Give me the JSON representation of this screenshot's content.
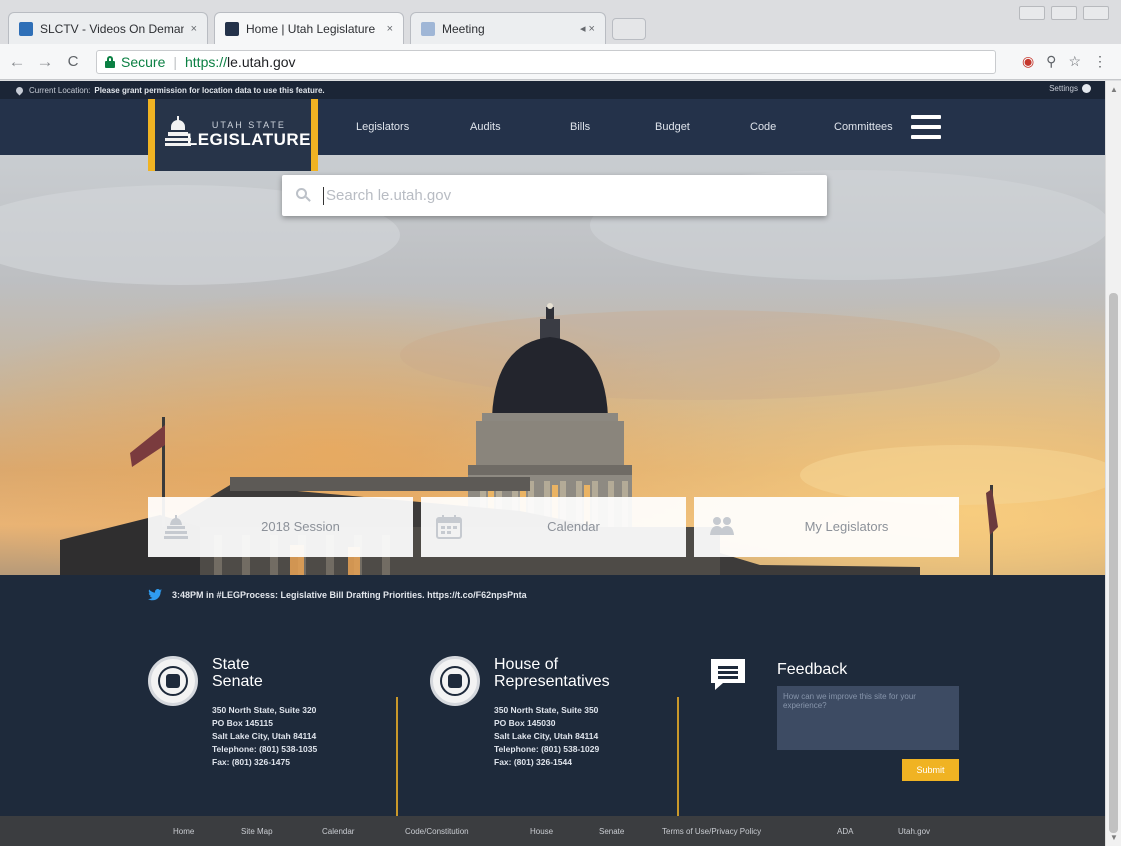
{
  "browser": {
    "tabs": [
      {
        "title": "SLCTV - Videos On Demand",
        "close": "×"
      },
      {
        "title": "Home | Utah Legislature",
        "close": "×"
      },
      {
        "title": "Meeting",
        "close": "◂ ×"
      }
    ],
    "nav": {
      "back": "←",
      "forward": "→",
      "reload": "C"
    },
    "omnibox": {
      "secure_label": "Secure",
      "separator": "|",
      "scheme": "https://",
      "host": "le.utah.gov"
    },
    "toolbar_right": {
      "extension": "◉",
      "zoom": "⚲",
      "star": "☆",
      "menu": "⋮"
    }
  },
  "location_bar": {
    "label": "Current Location:",
    "message": "Please grant permission for location data to use this feature.",
    "settings_label": "Settings"
  },
  "logo": {
    "small": "UTAH STATE",
    "big": "LEGISLATURE"
  },
  "nav_items": [
    "Legislators",
    "Audits",
    "Bills",
    "Budget",
    "Code",
    "Committees"
  ],
  "search": {
    "placeholder": "Search le.utah.gov"
  },
  "quick_links": [
    "2018 Session",
    "Calendar",
    "My Legislators"
  ],
  "tweet": {
    "text": "3:48PM in #LEGProcess: Legislative Bill Drafting Priorities. https://t.co/F62npsPnta"
  },
  "senate": {
    "title_line1": "State",
    "title_line2": "Senate",
    "address": [
      "350 North State, Suite 320",
      "PO Box 145115",
      "Salt Lake City, Utah 84114",
      "Telephone: (801) 538-1035",
      "Fax: (801) 326-1475"
    ]
  },
  "house": {
    "title_line1": "House of",
    "title_line2": "Representatives",
    "address": [
      "350 North State, Suite 350",
      "PO Box 145030",
      "Salt Lake City, Utah 84114",
      "Telephone: (801) 538-1029",
      "Fax: (801) 326-1544"
    ]
  },
  "feedback": {
    "title": "Feedback",
    "placeholder": "How can we improve this site for your experience?",
    "submit": "Submit"
  },
  "footer_links": [
    "Home",
    "Site Map",
    "Calendar",
    "Code/Constitution",
    "House",
    "Senate",
    "Terms of Use/Privacy Policy",
    "ADA",
    "Utah.gov"
  ],
  "colors": {
    "accent": "#f0b323",
    "navy": "#24324a",
    "footer": "#1e2a3b",
    "secure": "#0b8043"
  }
}
